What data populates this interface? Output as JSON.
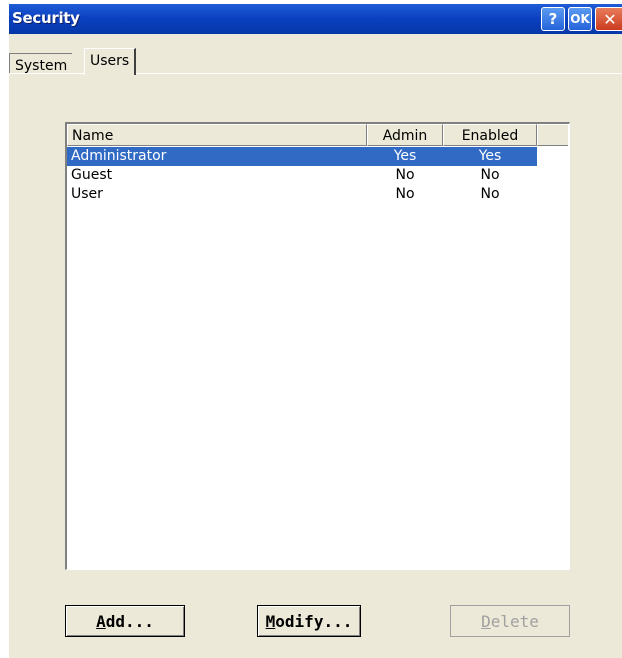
{
  "window": {
    "title": "Security",
    "help_label": "?",
    "ok_label": "OK",
    "close_label": "✕"
  },
  "tabs": [
    {
      "label": "System",
      "active": false
    },
    {
      "label": "Users",
      "active": true
    }
  ],
  "users_list": {
    "columns": [
      "Name",
      "Admin",
      "Enabled"
    ],
    "rows": [
      {
        "name": "Administrator",
        "admin": "Yes",
        "enabled": "Yes",
        "selected": true
      },
      {
        "name": "Guest",
        "admin": "No",
        "enabled": "No",
        "selected": false
      },
      {
        "name": "User",
        "admin": "No",
        "enabled": "No",
        "selected": false
      }
    ]
  },
  "buttons": {
    "add": {
      "mnemonic": "A",
      "rest": "dd..."
    },
    "modify": {
      "mnemonic": "M",
      "rest": "odify..."
    },
    "delete": {
      "mnemonic": "D",
      "rest": "elete",
      "enabled": false
    }
  },
  "colors": {
    "titlebar": "#0a3fc0",
    "selection": "#316ac5",
    "dialog_bg": "#ece9d8"
  }
}
